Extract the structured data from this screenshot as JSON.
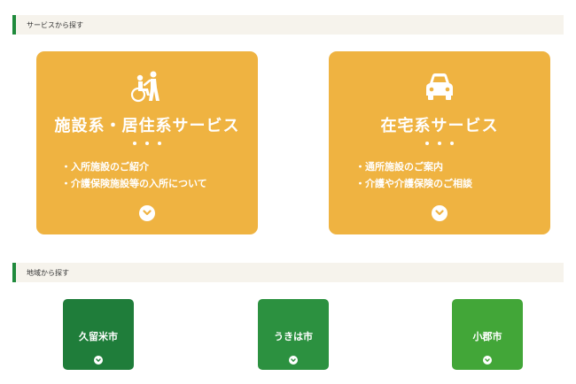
{
  "sections": {
    "services": {
      "title": "サービスから探す"
    },
    "regions": {
      "title": "地域から探す"
    }
  },
  "services": [
    {
      "icon": "wheelchair-caregiver-icon",
      "title": "施設系・居住系サービス",
      "items": [
        "入所施設のご紹介",
        "介護保険施設等の入所について"
      ]
    },
    {
      "icon": "car-icon",
      "title": "在宅系サービス",
      "items": [
        "通所施設のご案内",
        "介護や介護保険のご相談"
      ]
    }
  ],
  "regions": [
    {
      "name": "久留米市",
      "color": "#1f7d3a"
    },
    {
      "name": "うきは市",
      "color": "#2c9140"
    },
    {
      "name": "小郡市",
      "color": "#42a638"
    }
  ],
  "colors": {
    "service_card": "#efb341",
    "accent_green": "#1f8a3c",
    "header_background": "#f6f3ec"
  }
}
